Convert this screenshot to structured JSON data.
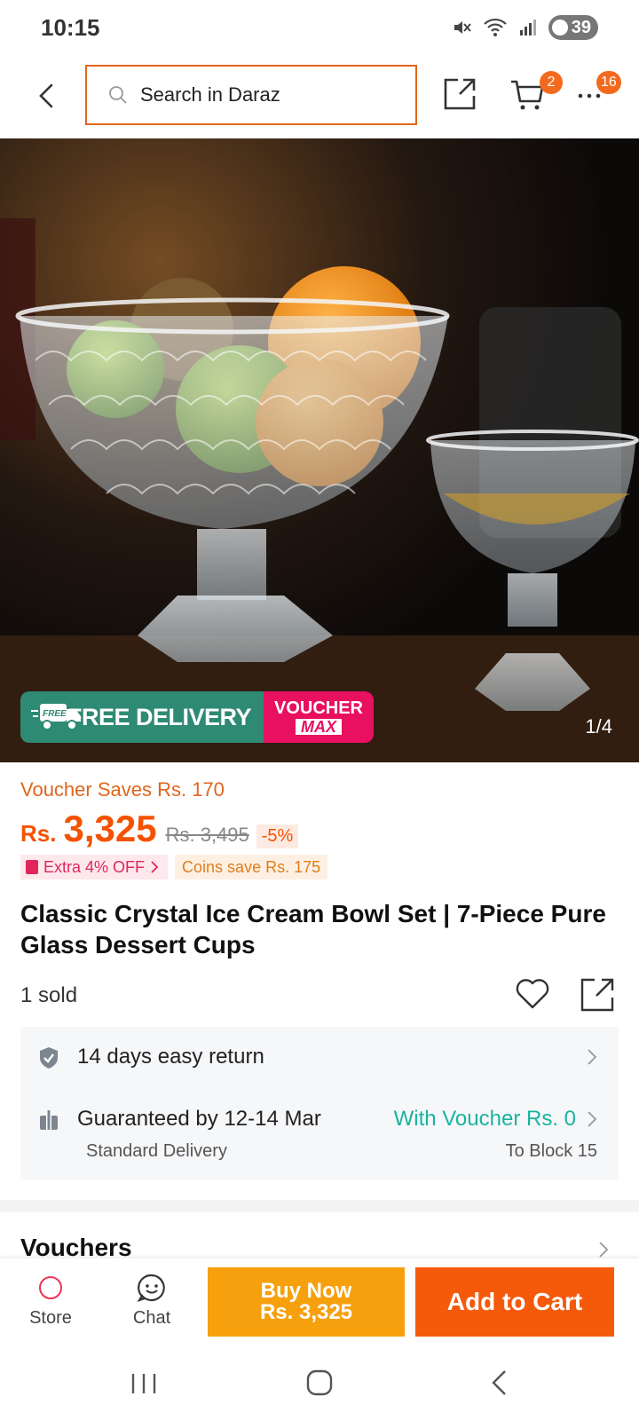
{
  "status_bar": {
    "time": "10:15",
    "battery": "39"
  },
  "header": {
    "search_placeholder": "Search in Daraz",
    "cart_count": "2",
    "more_count": "16"
  },
  "hero": {
    "image_counter": "1/4",
    "promo": {
      "free_delivery_badge": "FREE",
      "free_delivery": "FREE DELIVERY",
      "voucher_line1": "VOUCHER",
      "voucher_line2": "MAX"
    }
  },
  "price": {
    "voucher_saves": "Voucher Saves Rs. 170",
    "currency": "Rs.",
    "current": "3,325",
    "original": "Rs. 3,495",
    "discount": "-5%",
    "extra_off": "Extra 4% OFF",
    "coins_save": "Coins save Rs. 175"
  },
  "product": {
    "title": "Classic Crystal Ice Cream Bowl Set | 7-Piece Pure Glass Dessert Cups",
    "sold": "1 sold"
  },
  "info": {
    "return": "14 days easy return",
    "delivery": "Guaranteed by 12-14 Mar",
    "delivery_type": "Standard Delivery",
    "with_voucher": "With Voucher Rs. 0",
    "location": "To Block 15"
  },
  "vouchers": {
    "title": "Vouchers"
  },
  "bottom_bar": {
    "store": "Store",
    "chat": "Chat",
    "buy_now": "Buy Now",
    "buy_now_price": "Rs. 3,325",
    "add_to_cart": "Add to Cart"
  },
  "colors": {
    "accent": "#f55a0a",
    "buy_now": "#f6a00e",
    "teal": "#1ab3a0",
    "free_delivery": "#2e8a73",
    "voucher_max": "#e8105f"
  }
}
